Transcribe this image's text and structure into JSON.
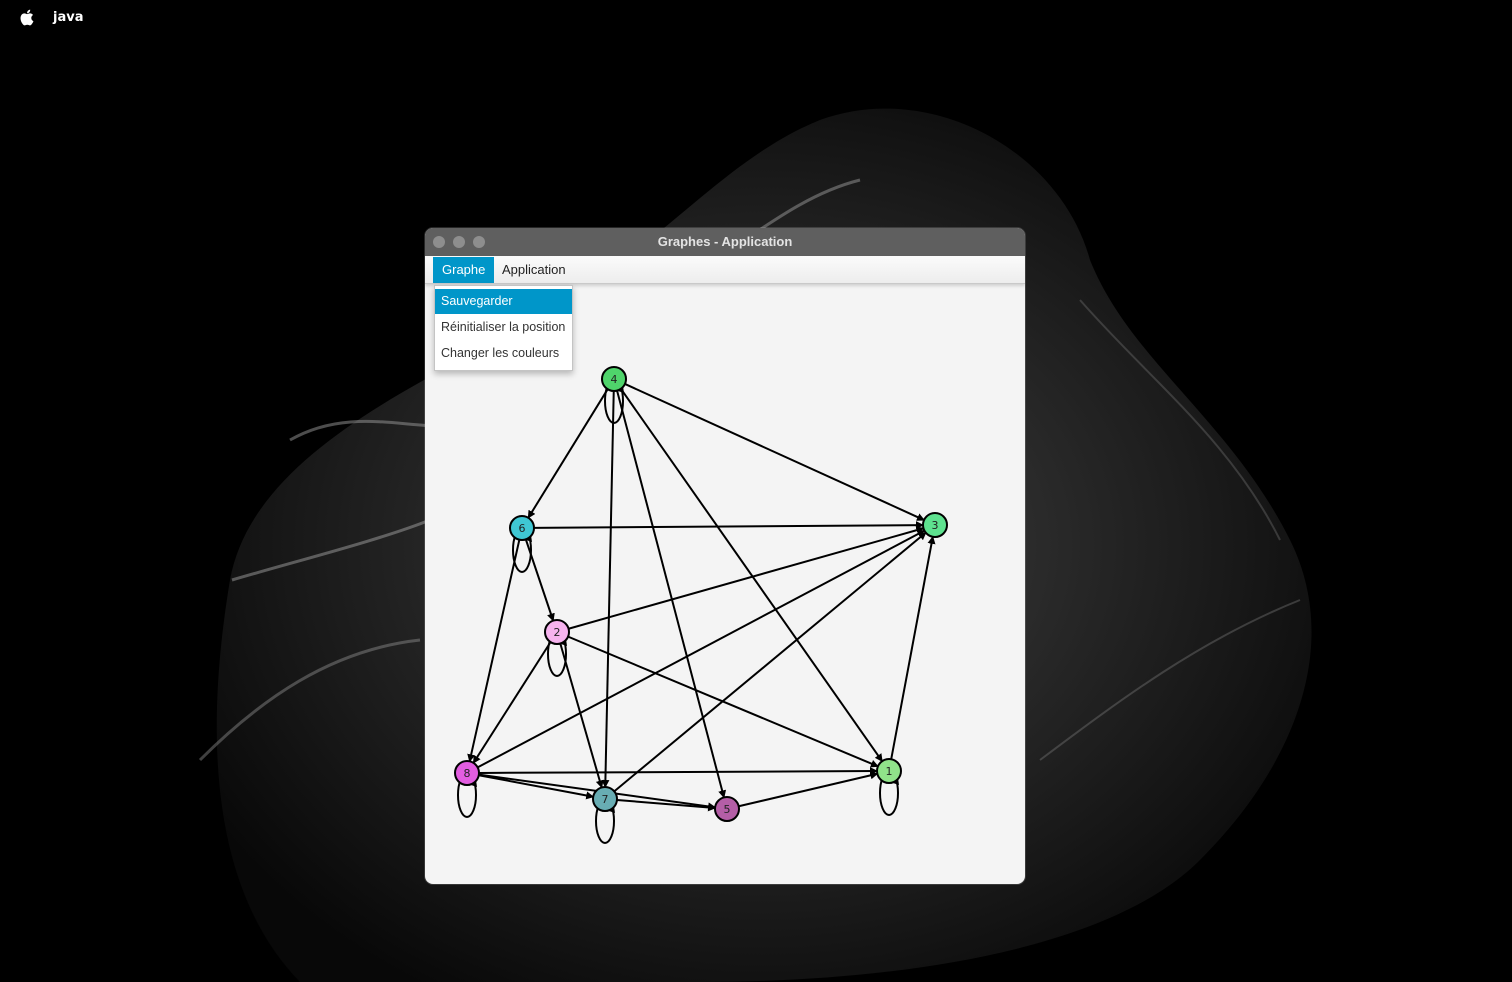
{
  "menubar": {
    "app_name": "java",
    "apple_icon": "apple-logo-icon"
  },
  "window": {
    "title": "Graphes - Application",
    "menu": {
      "items": [
        {
          "label": "Graphe",
          "active": true
        },
        {
          "label": "Application",
          "active": false
        }
      ]
    },
    "dropdown": {
      "items": [
        {
          "label": "Sauvegarder",
          "highlighted": true
        },
        {
          "label": "Réinitialiser la position",
          "highlighted": false
        },
        {
          "label": "Changer les couleurs",
          "highlighted": false
        }
      ]
    }
  },
  "colors": {
    "accent": "#0096c9",
    "titlebar": "#5f5f5f",
    "canvas": "#f4f4f4"
  },
  "graph": {
    "nodes": [
      {
        "id": "1",
        "label": "1",
        "color": "#90e38a"
      },
      {
        "id": "2",
        "label": "2",
        "color": "#f6b3ee"
      },
      {
        "id": "3",
        "label": "3",
        "color": "#5ee28f"
      },
      {
        "id": "4",
        "label": "4",
        "color": "#4fd46b"
      },
      {
        "id": "5",
        "label": "5",
        "color": "#b45ea6"
      },
      {
        "id": "6",
        "label": "6",
        "color": "#3fc7d3"
      },
      {
        "id": "7",
        "label": "7",
        "color": "#68adb3"
      },
      {
        "id": "8",
        "label": "8",
        "color": "#e25de0"
      }
    ],
    "edges": [
      [
        "4",
        "6"
      ],
      [
        "4",
        "7"
      ],
      [
        "4",
        "5"
      ],
      [
        "4",
        "1"
      ],
      [
        "4",
        "3"
      ],
      [
        "6",
        "3"
      ],
      [
        "6",
        "2"
      ],
      [
        "6",
        "8"
      ],
      [
        "2",
        "3"
      ],
      [
        "2",
        "8"
      ],
      [
        "2",
        "7"
      ],
      [
        "2",
        "1"
      ],
      [
        "8",
        "3"
      ],
      [
        "8",
        "1"
      ],
      [
        "8",
        "7"
      ],
      [
        "8",
        "5"
      ],
      [
        "7",
        "3"
      ],
      [
        "7",
        "5"
      ],
      [
        "5",
        "1"
      ],
      [
        "1",
        "3"
      ]
    ],
    "self_loops": [
      "4",
      "6",
      "2",
      "8",
      "7",
      "1"
    ]
  }
}
